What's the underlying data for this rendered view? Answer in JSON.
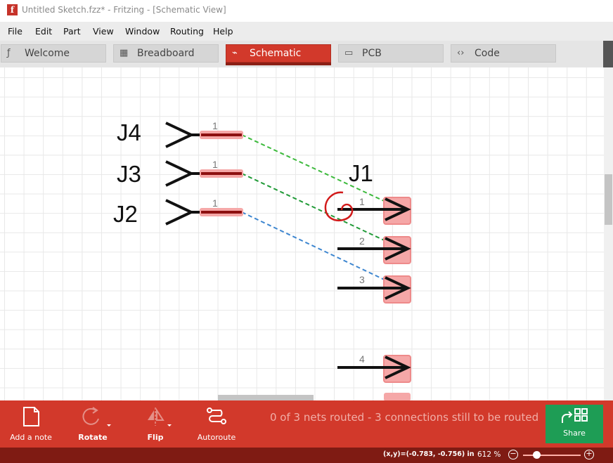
{
  "window": {
    "title": "Untitled Sketch.fzz* - Fritzing - [Schematic View]",
    "app_icon": "f"
  },
  "menu": [
    "File",
    "Edit",
    "Part",
    "View",
    "Window",
    "Routing",
    "Help"
  ],
  "tabs": [
    {
      "label": "Welcome",
      "icon": "welcome-icon",
      "glyph": "ƒ"
    },
    {
      "label": "Breadboard",
      "icon": "breadboard-icon",
      "glyph": "▦"
    },
    {
      "label": "Schematic",
      "icon": "schematic-icon",
      "glyph": "⌁",
      "active": true
    },
    {
      "label": "PCB",
      "icon": "pcb-icon",
      "glyph": "▭"
    },
    {
      "label": "Code",
      "icon": "code-icon",
      "glyph": "‹›"
    }
  ],
  "schematic": {
    "left_parts": [
      {
        "label": "J4",
        "pin": "1"
      },
      {
        "label": "J3",
        "pin": "1"
      },
      {
        "label": "J2",
        "pin": "1"
      }
    ],
    "right_part": {
      "label": "J1",
      "pins": [
        "1",
        "2",
        "3",
        "4"
      ]
    },
    "wire_colors": {
      "j4": "#3cba3c",
      "j3": "#1f9a36",
      "j2": "#3d86d0"
    },
    "logo": "fritzing"
  },
  "toolbar": {
    "add_note": "Add a note",
    "rotate": "Rotate",
    "flip": "Flip",
    "autoroute": "Autoroute",
    "routing_status": "0 of 3 nets routed - 3 connections still to be routed",
    "share": "Share"
  },
  "statusbar": {
    "coordinates": "(x,y)=(-0.783, -0.756) in",
    "zoom": "612 %",
    "zoom_out_symbol": "−",
    "zoom_in_symbol": "+"
  },
  "colors": {
    "accent": "#d2392b",
    "share": "#1e9d55",
    "statusbar": "#7f1b13"
  }
}
